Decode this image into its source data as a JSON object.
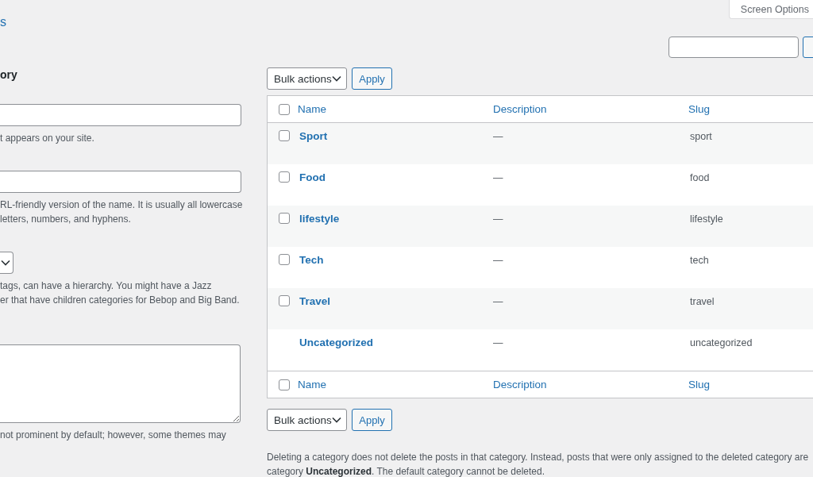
{
  "page_title_fragment": "s",
  "add_form": {
    "heading": "ory",
    "fields": [
      {
        "kind": "input",
        "hint_lines": [
          "t appears on your site."
        ]
      },
      {
        "kind": "input",
        "hint_lines": [
          "RL-friendly version of the name. It is usually all lowercase",
          "letters, numbers, and hyphens."
        ]
      },
      {
        "kind": "select",
        "hint_lines": [
          "tags, can have a hierarchy. You might have a Jazz",
          "er that have children categories for Bebop and Big Band."
        ]
      },
      {
        "kind": "textarea",
        "hint_lines": [
          "not prominent by default; however, some themes may"
        ]
      }
    ]
  },
  "screen_options": "Screen Options",
  "bulk_top": {
    "select": "Bulk actions",
    "apply": "Apply"
  },
  "table": {
    "columns": [
      "Name",
      "Description",
      "Slug"
    ],
    "footer_columns": [
      "Name",
      "Description",
      "Slug"
    ],
    "header_checked": false,
    "footer_checked": false,
    "rows": [
      {
        "name": "Sport",
        "description": "—",
        "slug": "sport",
        "checked": false
      },
      {
        "name": "Food",
        "description": "—",
        "slug": "food",
        "checked": false
      },
      {
        "name": "lifestyle",
        "description": "—",
        "slug": "lifestyle",
        "checked": false
      },
      {
        "name": "Tech",
        "description": "—",
        "slug": "tech",
        "checked": false
      },
      {
        "name": "Travel",
        "description": "—",
        "slug": "travel",
        "checked": false
      },
      {
        "name": "Uncategorized",
        "description": "—",
        "slug": "uncategorized"
      }
    ]
  },
  "bulk_bottom": {
    "select": "Bulk actions",
    "apply": "Apply"
  },
  "note_lines": [
    "Deleting a category does not delete the posts in that category. Instead, posts that were only assigned to the deleted category are",
    "category **Uncategorized**. The default category cannot be deleted."
  ]
}
